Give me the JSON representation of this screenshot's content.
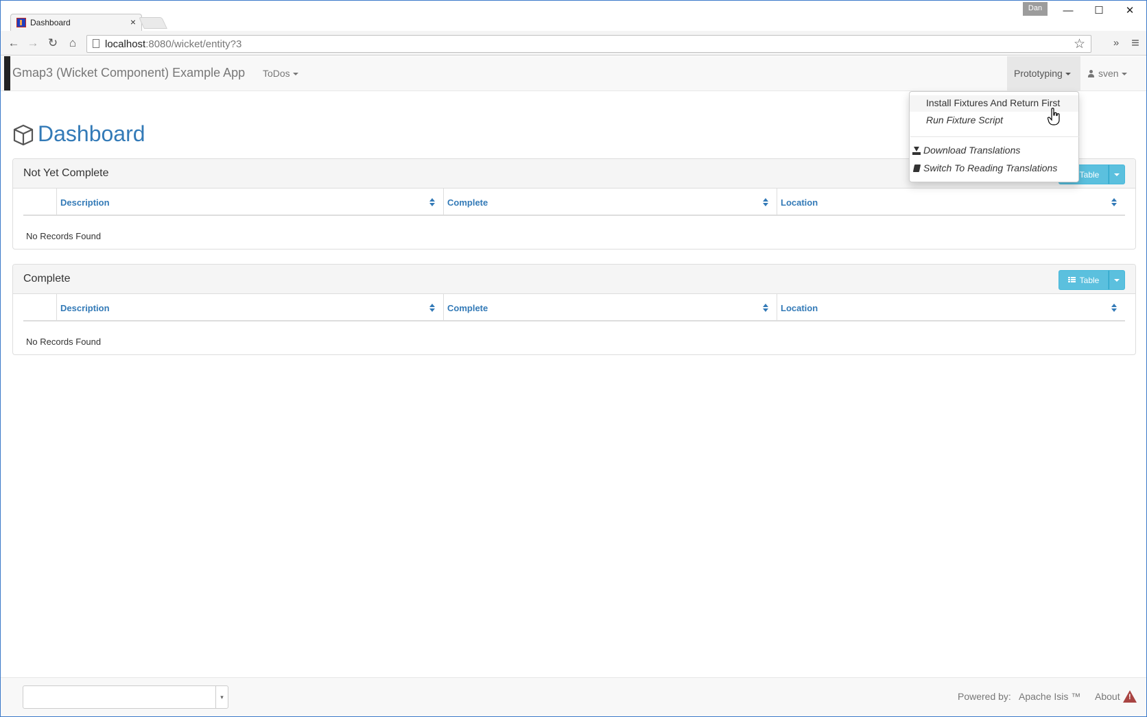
{
  "browser": {
    "tab_title": "Dashboard",
    "tab_close": "×",
    "user_badge": "Dan",
    "window_controls": {
      "minimize": "—",
      "maximize": "☐",
      "close": "✕"
    },
    "url_host": "localhost",
    "url_rest": ":8080/wicket/entity?3",
    "nav": {
      "back": "←",
      "forward": "→",
      "reload": "↻",
      "home": "⌂",
      "more": "»",
      "menu": "≡"
    }
  },
  "navbar": {
    "brand": "Gmap3 (Wicket Component) Example App",
    "todos": "ToDos",
    "prototyping": "Prototyping",
    "user": "sven"
  },
  "dropdown": {
    "items": [
      {
        "label": "Install Fixtures And Return First"
      },
      {
        "label": "Run Fixture Script"
      },
      {
        "label": "Download Translations",
        "icon": "download-icon"
      },
      {
        "label": "Switch To Reading Translations",
        "icon": "book-icon"
      }
    ]
  },
  "page": {
    "title": "Dashboard",
    "icon": "cube-icon"
  },
  "panels": [
    {
      "title": "Not Yet Complete",
      "view_button": "Table",
      "columns": [
        "Description",
        "Complete",
        "Location"
      ],
      "empty_text": "No Records Found"
    },
    {
      "title": "Complete",
      "view_button": "Table",
      "columns": [
        "Description",
        "Complete",
        "Location"
      ],
      "empty_text": "No Records Found"
    }
  ],
  "footer": {
    "select_arrow": "▾",
    "powered_by": "Powered by:",
    "isis": "Apache Isis ™",
    "about": "About"
  },
  "colors": {
    "link": "#337ab7",
    "info_button": "#5bc0de",
    "warning": "#a94442"
  }
}
